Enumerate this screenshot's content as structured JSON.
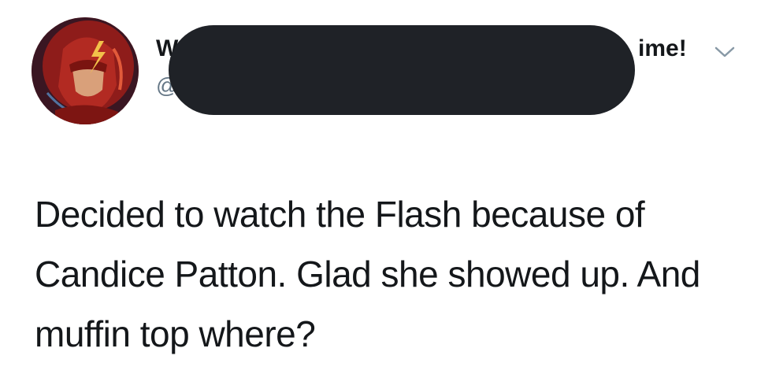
{
  "user": {
    "display_name_start": "W",
    "display_name_end": "ime!",
    "handle_start": "@"
  },
  "tweet": {
    "text": "Decided to watch the Flash because of Candice Patton. Glad she showed up. And muffin top where?"
  },
  "icons": {
    "menu": "chevron-down-icon",
    "avatar": "avatar"
  },
  "colors": {
    "text": "#14171a",
    "secondary_text": "#657786",
    "redaction": "#1f2227",
    "caret": "#8899a6"
  }
}
